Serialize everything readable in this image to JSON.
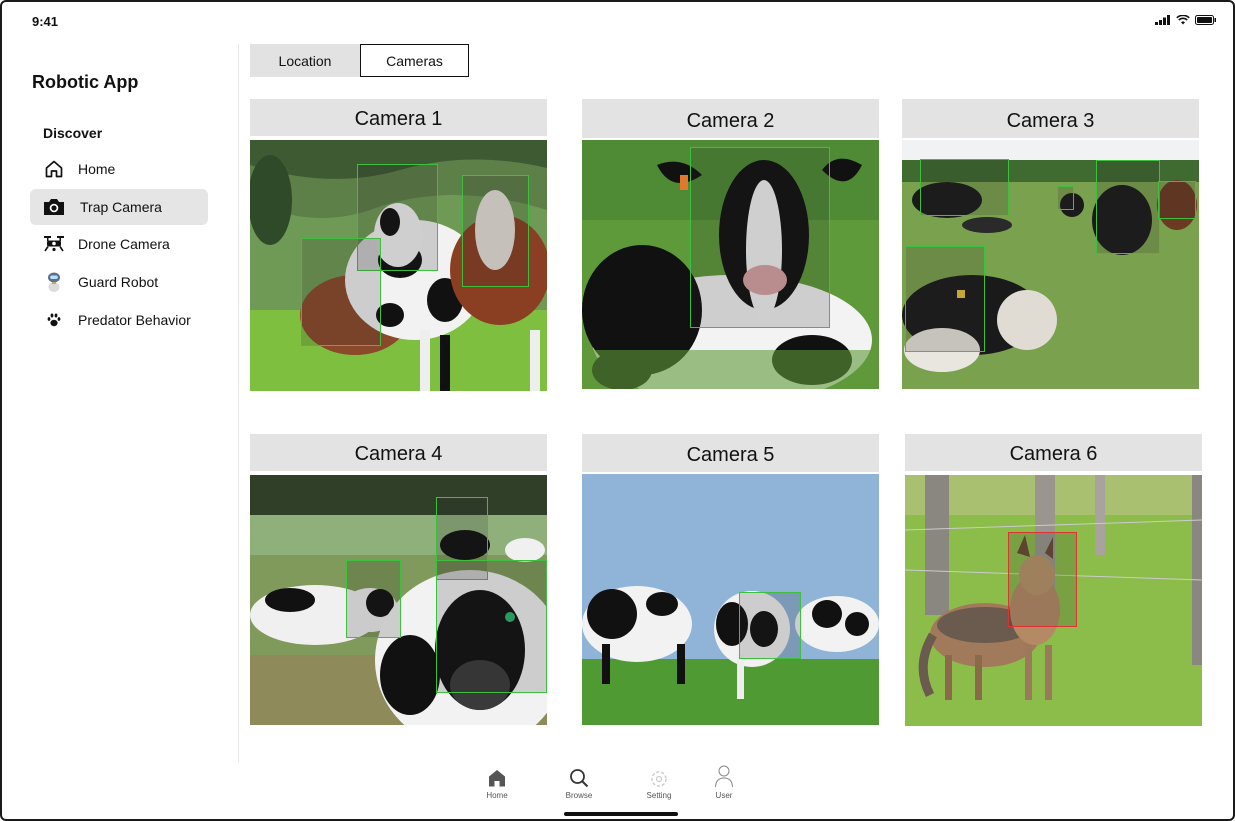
{
  "status_bar": {
    "time": "9:41"
  },
  "app": {
    "title": "Robotic App"
  },
  "sidebar": {
    "section_label": "Discover",
    "items": [
      {
        "label": "Home",
        "icon": "home-icon",
        "active": false
      },
      {
        "label": "Trap Camera",
        "icon": "camera-icon",
        "active": true
      },
      {
        "label": "Drone Camera",
        "icon": "drone-icon",
        "active": false
      },
      {
        "label": "Guard Robot",
        "icon": "robot-icon",
        "active": false
      },
      {
        "label": "Predator Behavior",
        "icon": "paw-icon",
        "active": false
      }
    ]
  },
  "tabs": [
    {
      "label": "Location",
      "active": false
    },
    {
      "label": "Cameras",
      "active": true
    }
  ],
  "cameras": [
    {
      "title": "Camera 1"
    },
    {
      "title": "Camera 2"
    },
    {
      "title": "Camera 3"
    },
    {
      "title": "Camera 4"
    },
    {
      "title": "Camera 5"
    },
    {
      "title": "Camera 6"
    }
  ],
  "bottom_nav": [
    {
      "label": "Home",
      "icon": "home-icon"
    },
    {
      "label": "Browse",
      "icon": "search-icon"
    },
    {
      "label": "Setting",
      "icon": "gear-icon"
    },
    {
      "label": "User",
      "icon": "user-icon"
    }
  ],
  "colors": {
    "detection_box": "#3fbf3f",
    "predator_box": "#d33333",
    "active_nav_bg": "#e5e5e5",
    "card_header_bg": "#e3e3e3"
  }
}
